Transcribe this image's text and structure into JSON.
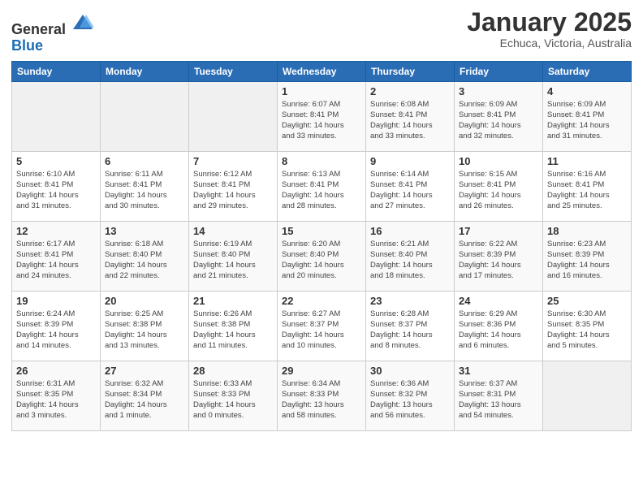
{
  "logo": {
    "general": "General",
    "blue": "Blue"
  },
  "header": {
    "title": "January 2025",
    "subtitle": "Echuca, Victoria, Australia"
  },
  "weekdays": [
    "Sunday",
    "Monday",
    "Tuesday",
    "Wednesday",
    "Thursday",
    "Friday",
    "Saturday"
  ],
  "weeks": [
    [
      {
        "day": "",
        "info": ""
      },
      {
        "day": "",
        "info": ""
      },
      {
        "day": "",
        "info": ""
      },
      {
        "day": "1",
        "info": "Sunrise: 6:07 AM\nSunset: 8:41 PM\nDaylight: 14 hours\nand 33 minutes."
      },
      {
        "day": "2",
        "info": "Sunrise: 6:08 AM\nSunset: 8:41 PM\nDaylight: 14 hours\nand 33 minutes."
      },
      {
        "day": "3",
        "info": "Sunrise: 6:09 AM\nSunset: 8:41 PM\nDaylight: 14 hours\nand 32 minutes."
      },
      {
        "day": "4",
        "info": "Sunrise: 6:09 AM\nSunset: 8:41 PM\nDaylight: 14 hours\nand 31 minutes."
      }
    ],
    [
      {
        "day": "5",
        "info": "Sunrise: 6:10 AM\nSunset: 8:41 PM\nDaylight: 14 hours\nand 31 minutes."
      },
      {
        "day": "6",
        "info": "Sunrise: 6:11 AM\nSunset: 8:41 PM\nDaylight: 14 hours\nand 30 minutes."
      },
      {
        "day": "7",
        "info": "Sunrise: 6:12 AM\nSunset: 8:41 PM\nDaylight: 14 hours\nand 29 minutes."
      },
      {
        "day": "8",
        "info": "Sunrise: 6:13 AM\nSunset: 8:41 PM\nDaylight: 14 hours\nand 28 minutes."
      },
      {
        "day": "9",
        "info": "Sunrise: 6:14 AM\nSunset: 8:41 PM\nDaylight: 14 hours\nand 27 minutes."
      },
      {
        "day": "10",
        "info": "Sunrise: 6:15 AM\nSunset: 8:41 PM\nDaylight: 14 hours\nand 26 minutes."
      },
      {
        "day": "11",
        "info": "Sunrise: 6:16 AM\nSunset: 8:41 PM\nDaylight: 14 hours\nand 25 minutes."
      }
    ],
    [
      {
        "day": "12",
        "info": "Sunrise: 6:17 AM\nSunset: 8:41 PM\nDaylight: 14 hours\nand 24 minutes."
      },
      {
        "day": "13",
        "info": "Sunrise: 6:18 AM\nSunset: 8:40 PM\nDaylight: 14 hours\nand 22 minutes."
      },
      {
        "day": "14",
        "info": "Sunrise: 6:19 AM\nSunset: 8:40 PM\nDaylight: 14 hours\nand 21 minutes."
      },
      {
        "day": "15",
        "info": "Sunrise: 6:20 AM\nSunset: 8:40 PM\nDaylight: 14 hours\nand 20 minutes."
      },
      {
        "day": "16",
        "info": "Sunrise: 6:21 AM\nSunset: 8:40 PM\nDaylight: 14 hours\nand 18 minutes."
      },
      {
        "day": "17",
        "info": "Sunrise: 6:22 AM\nSunset: 8:39 PM\nDaylight: 14 hours\nand 17 minutes."
      },
      {
        "day": "18",
        "info": "Sunrise: 6:23 AM\nSunset: 8:39 PM\nDaylight: 14 hours\nand 16 minutes."
      }
    ],
    [
      {
        "day": "19",
        "info": "Sunrise: 6:24 AM\nSunset: 8:39 PM\nDaylight: 14 hours\nand 14 minutes."
      },
      {
        "day": "20",
        "info": "Sunrise: 6:25 AM\nSunset: 8:38 PM\nDaylight: 14 hours\nand 13 minutes."
      },
      {
        "day": "21",
        "info": "Sunrise: 6:26 AM\nSunset: 8:38 PM\nDaylight: 14 hours\nand 11 minutes."
      },
      {
        "day": "22",
        "info": "Sunrise: 6:27 AM\nSunset: 8:37 PM\nDaylight: 14 hours\nand 10 minutes."
      },
      {
        "day": "23",
        "info": "Sunrise: 6:28 AM\nSunset: 8:37 PM\nDaylight: 14 hours\nand 8 minutes."
      },
      {
        "day": "24",
        "info": "Sunrise: 6:29 AM\nSunset: 8:36 PM\nDaylight: 14 hours\nand 6 minutes."
      },
      {
        "day": "25",
        "info": "Sunrise: 6:30 AM\nSunset: 8:35 PM\nDaylight: 14 hours\nand 5 minutes."
      }
    ],
    [
      {
        "day": "26",
        "info": "Sunrise: 6:31 AM\nSunset: 8:35 PM\nDaylight: 14 hours\nand 3 minutes."
      },
      {
        "day": "27",
        "info": "Sunrise: 6:32 AM\nSunset: 8:34 PM\nDaylight: 14 hours\nand 1 minute."
      },
      {
        "day": "28",
        "info": "Sunrise: 6:33 AM\nSunset: 8:33 PM\nDaylight: 14 hours\nand 0 minutes."
      },
      {
        "day": "29",
        "info": "Sunrise: 6:34 AM\nSunset: 8:33 PM\nDaylight: 13 hours\nand 58 minutes."
      },
      {
        "day": "30",
        "info": "Sunrise: 6:36 AM\nSunset: 8:32 PM\nDaylight: 13 hours\nand 56 minutes."
      },
      {
        "day": "31",
        "info": "Sunrise: 6:37 AM\nSunset: 8:31 PM\nDaylight: 13 hours\nand 54 minutes."
      },
      {
        "day": "",
        "info": ""
      }
    ]
  ]
}
